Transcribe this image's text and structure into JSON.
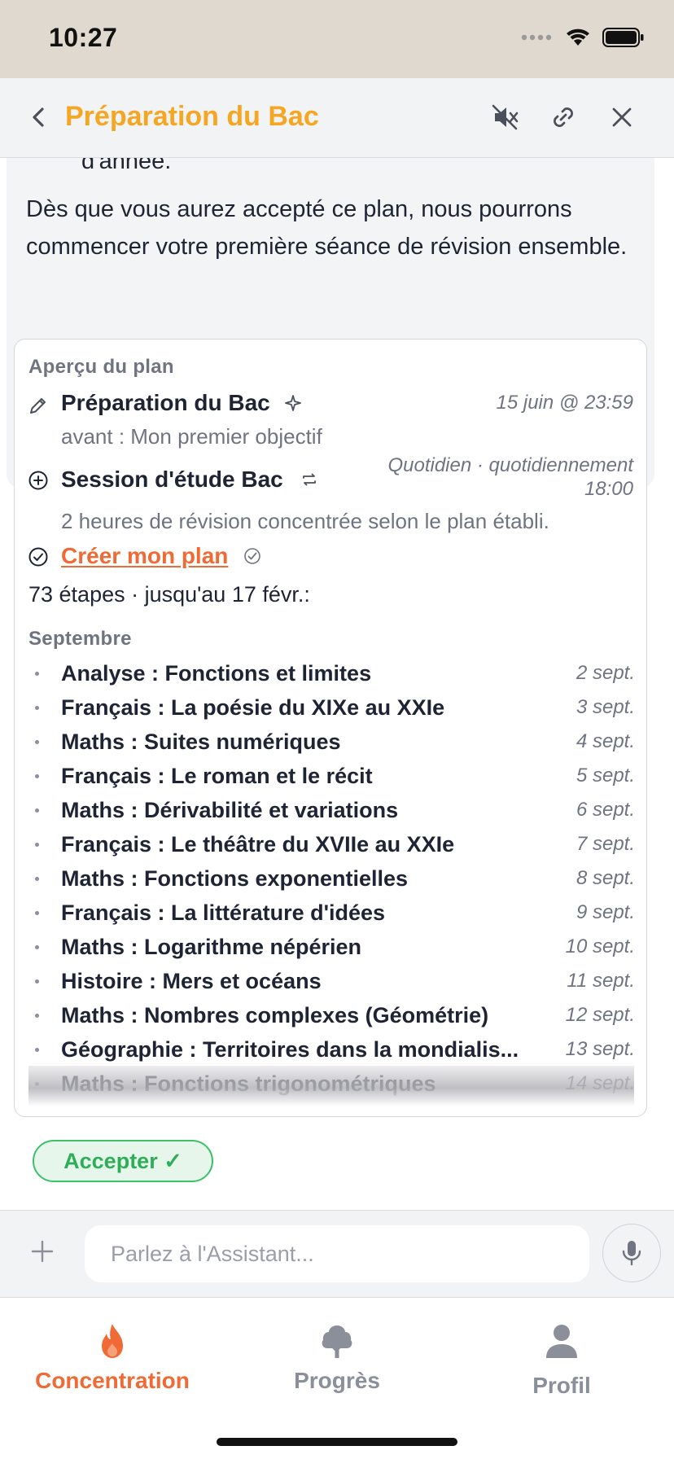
{
  "status_bar": {
    "time": "10:27"
  },
  "header": {
    "title": "Préparation du Bac"
  },
  "message": {
    "previous_line": "d'année.",
    "text": "Dès que vous aurez accepté ce plan, nous pourrons commencer votre première séance de révision ensemble."
  },
  "plan": {
    "heading": "Aperçu du plan",
    "goal": {
      "title": "Préparation du Bac",
      "date": "15 juin @ 23:59",
      "subtitle": "avant : Mon premier objectif"
    },
    "session": {
      "title": "Session d'étude Bac",
      "frequency": "Quotidien · quotidiennement 18:00",
      "subtitle": "2 heures de révision concentrée selon le plan établi."
    },
    "create": {
      "label": "Créer mon plan"
    },
    "steps_summary": "73 étapes · jusqu'au 17 févr.:",
    "month": "Septembre",
    "steps": [
      {
        "name": "Analyse : Fonctions et limites",
        "date": "2 sept."
      },
      {
        "name": "Français : La poésie du XIXe au XXIe",
        "date": "3 sept."
      },
      {
        "name": "Maths : Suites numériques",
        "date": "4 sept."
      },
      {
        "name": "Français : Le roman et le récit",
        "date": "5 sept."
      },
      {
        "name": "Maths : Dérivabilité et variations",
        "date": "6 sept."
      },
      {
        "name": "Français : Le théâtre du XVIIe au XXIe",
        "date": "7 sept."
      },
      {
        "name": "Maths : Fonctions exponentielles",
        "date": "8 sept."
      },
      {
        "name": "Français : La littérature d'idées",
        "date": "9 sept."
      },
      {
        "name": "Maths : Logarithme népérien",
        "date": "10 sept."
      },
      {
        "name": "Histoire : Mers et océans",
        "date": "11 sept."
      },
      {
        "name": "Maths : Nombres complexes (Géométrie)",
        "date": "12 sept."
      },
      {
        "name": "Géographie : Territoires dans la mondialis...",
        "date": "13 sept."
      },
      {
        "name": "Maths : Fonctions trigonométriques",
        "date": "14 sept."
      }
    ]
  },
  "accept_button": {
    "label": "Accepter ✓"
  },
  "input": {
    "placeholder": "Parlez à l'Assistant..."
  },
  "tabs": [
    {
      "label": "Concentration",
      "icon": "flame-icon",
      "active": true
    },
    {
      "label": "Progrès",
      "icon": "tree-icon",
      "active": false
    },
    {
      "label": "Profil",
      "icon": "person-icon",
      "active": false
    }
  ],
  "colors": {
    "accent_orange": "#f06a35",
    "title_orange": "#f5a623",
    "accept_green": "#3ebf6a"
  }
}
